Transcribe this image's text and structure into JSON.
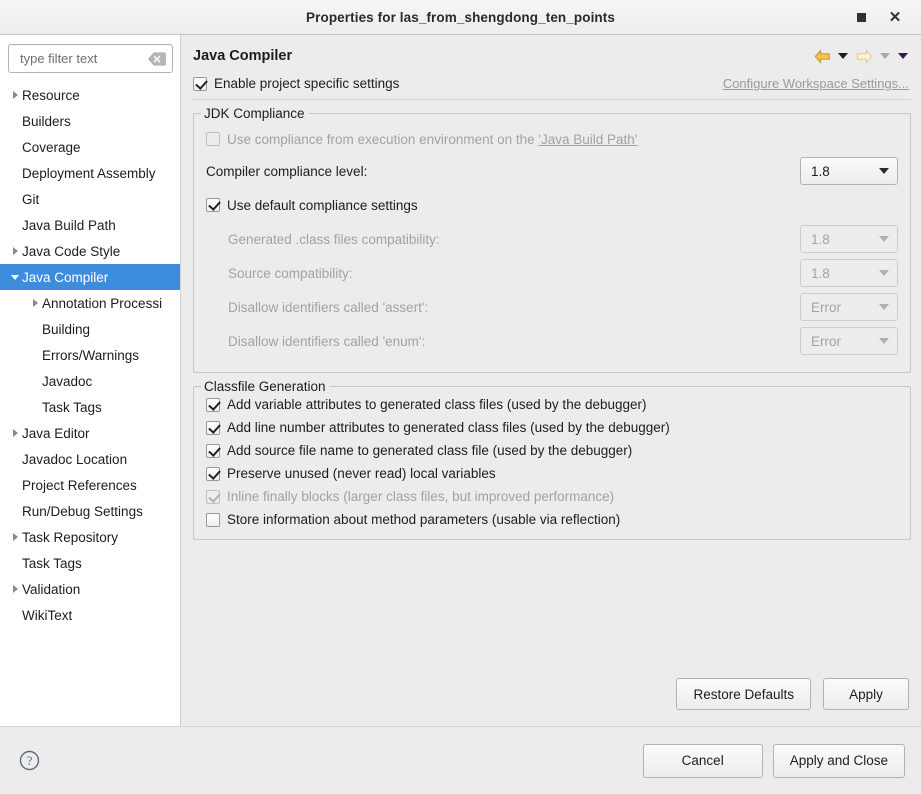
{
  "window": {
    "title": "Properties for las_from_shengdong_ten_points",
    "maximize_label": "Maximize",
    "close_label": "Close"
  },
  "sidebar": {
    "filter": {
      "placeholder": "type filter text",
      "value": "",
      "clear_icon": "clear-icon"
    },
    "items": [
      {
        "label": "Resource",
        "indent": 0,
        "twisty": "right",
        "selected": false
      },
      {
        "label": "Builders",
        "indent": 0,
        "twisty": "none",
        "selected": false
      },
      {
        "label": "Coverage",
        "indent": 0,
        "twisty": "none",
        "selected": false
      },
      {
        "label": "Deployment Assembly",
        "indent": 0,
        "twisty": "none",
        "selected": false
      },
      {
        "label": "Git",
        "indent": 0,
        "twisty": "none",
        "selected": false
      },
      {
        "label": "Java Build Path",
        "indent": 0,
        "twisty": "none",
        "selected": false
      },
      {
        "label": "Java Code Style",
        "indent": 0,
        "twisty": "right",
        "selected": false
      },
      {
        "label": "Java Compiler",
        "indent": 0,
        "twisty": "down",
        "selected": true
      },
      {
        "label": "Annotation Processi",
        "indent": 1,
        "twisty": "right",
        "selected": false
      },
      {
        "label": "Building",
        "indent": 1,
        "twisty": "none",
        "selected": false
      },
      {
        "label": "Errors/Warnings",
        "indent": 1,
        "twisty": "none",
        "selected": false
      },
      {
        "label": "Javadoc",
        "indent": 1,
        "twisty": "none",
        "selected": false
      },
      {
        "label": "Task Tags",
        "indent": 1,
        "twisty": "none",
        "selected": false
      },
      {
        "label": "Java Editor",
        "indent": 0,
        "twisty": "right",
        "selected": false
      },
      {
        "label": "Javadoc Location",
        "indent": 0,
        "twisty": "none",
        "selected": false
      },
      {
        "label": "Project References",
        "indent": 0,
        "twisty": "none",
        "selected": false
      },
      {
        "label": "Run/Debug Settings",
        "indent": 0,
        "twisty": "none",
        "selected": false
      },
      {
        "label": "Task Repository",
        "indent": 0,
        "twisty": "right",
        "selected": false
      },
      {
        "label": "Task Tags",
        "indent": 0,
        "twisty": "none",
        "selected": false
      },
      {
        "label": "Validation",
        "indent": 0,
        "twisty": "right",
        "selected": false
      },
      {
        "label": "WikiText",
        "indent": 0,
        "twisty": "none",
        "selected": false
      }
    ]
  },
  "page": {
    "title": "Java Compiler",
    "nav": {
      "back_icon": "back-arrow-icon",
      "back_menu_icon": "chevron-down-icon",
      "forward_icon": "forward-arrow-icon",
      "forward_menu_icon": "chevron-down-icon",
      "history_menu_icon": "chevron-down-icon"
    },
    "enable_project_specific": {
      "label": "Enable project specific settings",
      "checked": true,
      "enabled": true
    },
    "configure_workspace_link": "Configure Workspace Settings..."
  },
  "jdk_compliance": {
    "legend": "JDK Compliance",
    "use_execution_env": {
      "label_pre": "Use compliance from execution environment on the ",
      "label_link": "'Java Build Path'",
      "checked": false,
      "enabled": false
    },
    "compiler_compliance_level": {
      "label": "Compiler compliance level:",
      "value": "1.8",
      "enabled": true
    },
    "use_default_compliance": {
      "label": "Use default compliance settings",
      "checked": true,
      "enabled": true
    },
    "generated_class_compat": {
      "label": "Generated .class files compatibility:",
      "value": "1.8",
      "enabled": false
    },
    "source_compat": {
      "label": "Source compatibility:",
      "value": "1.8",
      "enabled": false
    },
    "disallow_assert": {
      "label": "Disallow identifiers called 'assert':",
      "value": "Error",
      "enabled": false
    },
    "disallow_enum": {
      "label": "Disallow identifiers called 'enum':",
      "value": "Error",
      "enabled": false
    }
  },
  "classfile_generation": {
    "legend": "Classfile Generation",
    "options": [
      {
        "label": "Add variable attributes to generated class files (used by the debugger)",
        "checked": true,
        "enabled": true
      },
      {
        "label": "Add line number attributes to generated class files (used by the debugger)",
        "checked": true,
        "enabled": true
      },
      {
        "label": "Add source file name to generated class file (used by the debugger)",
        "checked": true,
        "enabled": true
      },
      {
        "label": "Preserve unused (never read) local variables",
        "checked": true,
        "enabled": true
      },
      {
        "label": "Inline finally blocks (larger class files, but improved performance)",
        "checked": true,
        "enabled": false
      },
      {
        "label": "Store information about method parameters (usable via reflection)",
        "checked": false,
        "enabled": true
      }
    ]
  },
  "pane_actions": {
    "restore_defaults": "Restore Defaults",
    "apply": "Apply"
  },
  "footer": {
    "help_icon": "help-icon",
    "cancel": "Cancel",
    "apply_and_close": "Apply and Close"
  },
  "colors": {
    "selection_blue": "#3d8ddf",
    "panel_bg": "#ececec",
    "tree_bg": "#ffffff",
    "back_arrow_gold": "#e8a317",
    "forward_arrow_pale": "#f5dfae",
    "link_gray": "#9a9a9a"
  }
}
